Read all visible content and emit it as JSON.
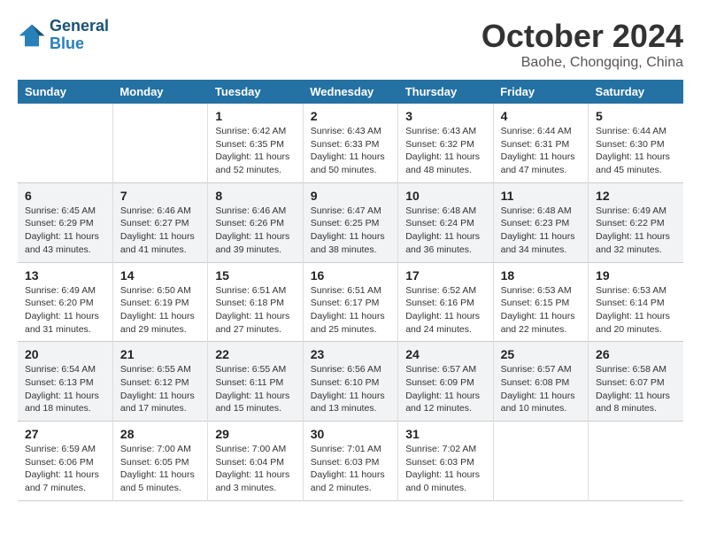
{
  "header": {
    "logo_line1": "General",
    "logo_line2": "Blue",
    "month_title": "October 2024",
    "location": "Baohe, Chongqing, China"
  },
  "weekdays": [
    "Sunday",
    "Monday",
    "Tuesday",
    "Wednesday",
    "Thursday",
    "Friday",
    "Saturday"
  ],
  "weeks": [
    [
      {
        "day": "",
        "info": ""
      },
      {
        "day": "",
        "info": ""
      },
      {
        "day": "1",
        "info": "Sunrise: 6:42 AM\nSunset: 6:35 PM\nDaylight: 11 hours and 52 minutes."
      },
      {
        "day": "2",
        "info": "Sunrise: 6:43 AM\nSunset: 6:33 PM\nDaylight: 11 hours and 50 minutes."
      },
      {
        "day": "3",
        "info": "Sunrise: 6:43 AM\nSunset: 6:32 PM\nDaylight: 11 hours and 48 minutes."
      },
      {
        "day": "4",
        "info": "Sunrise: 6:44 AM\nSunset: 6:31 PM\nDaylight: 11 hours and 47 minutes."
      },
      {
        "day": "5",
        "info": "Sunrise: 6:44 AM\nSunset: 6:30 PM\nDaylight: 11 hours and 45 minutes."
      }
    ],
    [
      {
        "day": "6",
        "info": "Sunrise: 6:45 AM\nSunset: 6:29 PM\nDaylight: 11 hours and 43 minutes."
      },
      {
        "day": "7",
        "info": "Sunrise: 6:46 AM\nSunset: 6:27 PM\nDaylight: 11 hours and 41 minutes."
      },
      {
        "day": "8",
        "info": "Sunrise: 6:46 AM\nSunset: 6:26 PM\nDaylight: 11 hours and 39 minutes."
      },
      {
        "day": "9",
        "info": "Sunrise: 6:47 AM\nSunset: 6:25 PM\nDaylight: 11 hours and 38 minutes."
      },
      {
        "day": "10",
        "info": "Sunrise: 6:48 AM\nSunset: 6:24 PM\nDaylight: 11 hours and 36 minutes."
      },
      {
        "day": "11",
        "info": "Sunrise: 6:48 AM\nSunset: 6:23 PM\nDaylight: 11 hours and 34 minutes."
      },
      {
        "day": "12",
        "info": "Sunrise: 6:49 AM\nSunset: 6:22 PM\nDaylight: 11 hours and 32 minutes."
      }
    ],
    [
      {
        "day": "13",
        "info": "Sunrise: 6:49 AM\nSunset: 6:20 PM\nDaylight: 11 hours and 31 minutes."
      },
      {
        "day": "14",
        "info": "Sunrise: 6:50 AM\nSunset: 6:19 PM\nDaylight: 11 hours and 29 minutes."
      },
      {
        "day": "15",
        "info": "Sunrise: 6:51 AM\nSunset: 6:18 PM\nDaylight: 11 hours and 27 minutes."
      },
      {
        "day": "16",
        "info": "Sunrise: 6:51 AM\nSunset: 6:17 PM\nDaylight: 11 hours and 25 minutes."
      },
      {
        "day": "17",
        "info": "Sunrise: 6:52 AM\nSunset: 6:16 PM\nDaylight: 11 hours and 24 minutes."
      },
      {
        "day": "18",
        "info": "Sunrise: 6:53 AM\nSunset: 6:15 PM\nDaylight: 11 hours and 22 minutes."
      },
      {
        "day": "19",
        "info": "Sunrise: 6:53 AM\nSunset: 6:14 PM\nDaylight: 11 hours and 20 minutes."
      }
    ],
    [
      {
        "day": "20",
        "info": "Sunrise: 6:54 AM\nSunset: 6:13 PM\nDaylight: 11 hours and 18 minutes."
      },
      {
        "day": "21",
        "info": "Sunrise: 6:55 AM\nSunset: 6:12 PM\nDaylight: 11 hours and 17 minutes."
      },
      {
        "day": "22",
        "info": "Sunrise: 6:55 AM\nSunset: 6:11 PM\nDaylight: 11 hours and 15 minutes."
      },
      {
        "day": "23",
        "info": "Sunrise: 6:56 AM\nSunset: 6:10 PM\nDaylight: 11 hours and 13 minutes."
      },
      {
        "day": "24",
        "info": "Sunrise: 6:57 AM\nSunset: 6:09 PM\nDaylight: 11 hours and 12 minutes."
      },
      {
        "day": "25",
        "info": "Sunrise: 6:57 AM\nSunset: 6:08 PM\nDaylight: 11 hours and 10 minutes."
      },
      {
        "day": "26",
        "info": "Sunrise: 6:58 AM\nSunset: 6:07 PM\nDaylight: 11 hours and 8 minutes."
      }
    ],
    [
      {
        "day": "27",
        "info": "Sunrise: 6:59 AM\nSunset: 6:06 PM\nDaylight: 11 hours and 7 minutes."
      },
      {
        "day": "28",
        "info": "Sunrise: 7:00 AM\nSunset: 6:05 PM\nDaylight: 11 hours and 5 minutes."
      },
      {
        "day": "29",
        "info": "Sunrise: 7:00 AM\nSunset: 6:04 PM\nDaylight: 11 hours and 3 minutes."
      },
      {
        "day": "30",
        "info": "Sunrise: 7:01 AM\nSunset: 6:03 PM\nDaylight: 11 hours and 2 minutes."
      },
      {
        "day": "31",
        "info": "Sunrise: 7:02 AM\nSunset: 6:03 PM\nDaylight: 11 hours and 0 minutes."
      },
      {
        "day": "",
        "info": ""
      },
      {
        "day": "",
        "info": ""
      }
    ]
  ]
}
